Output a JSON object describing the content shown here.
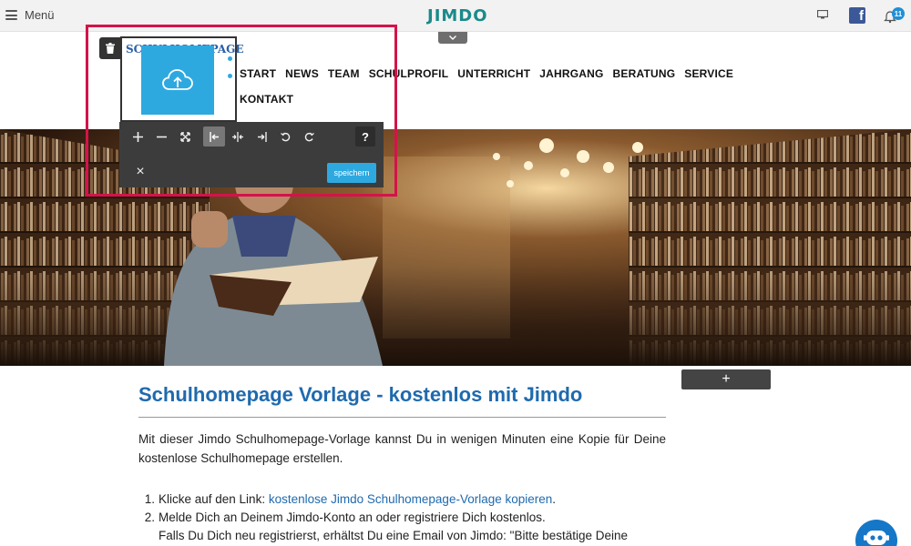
{
  "topbar": {
    "menu_label": "Menü",
    "logo": "JIMDO",
    "notification_count": "11"
  },
  "site": {
    "logo_text": "SCHULHOMEPAGE",
    "nav_row1": [
      "START",
      "NEWS",
      "TEAM",
      "SCHULPROFIL",
      "UNTERRICHT",
      "JAHRGANG",
      "BERATUNG",
      "SERVICE"
    ],
    "nav_row2": [
      "KONTAKT"
    ]
  },
  "editor": {
    "help_label": "?",
    "save_label": "speichern",
    "close_label": "×",
    "add_label": "+"
  },
  "content": {
    "title": "Schulhomepage Vorlage - kostenlos mit Jimdo",
    "intro": "Mit dieser Jimdo Schulhomepage-Vorlage kannst Du in wenigen Minuten eine Kopie für Deine kostenlose Schulhomepage erstellen.",
    "step1_prefix": "Klicke auf den Link: ",
    "step1_link": "kostenlose Jimdo Schulhomepage-Vorlage kopieren",
    "step1_suffix": ".",
    "step2": "Melde Dich an Deinem Jimdo-Konto an oder registriere Dich kostenlos.",
    "step2_cont": "Falls Du Dich neu registrierst, erhältst Du eine Email von Jimdo: \"Bitte bestätige Deine Email-"
  },
  "colors": {
    "accent": "#2ea9e0",
    "title_blue": "#1f6aae",
    "highlight": "#d4134a",
    "jimdo_teal": "#1a8a8a"
  }
}
